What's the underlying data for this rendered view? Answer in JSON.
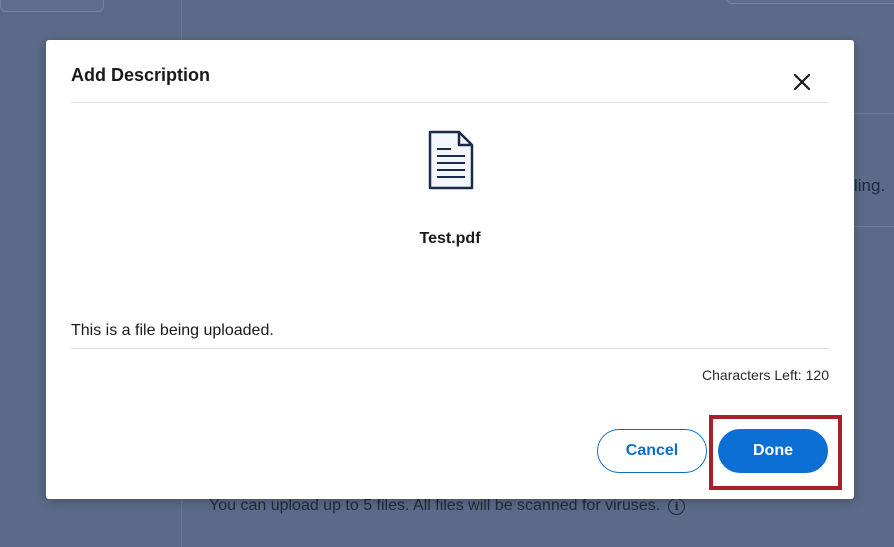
{
  "background": {
    "right_text": "ling.",
    "footer_text": "You can upload up to 5 files. All files will be scanned for viruses."
  },
  "modal": {
    "title": "Add Description",
    "file_name": "Test.pdf",
    "description_value": "This is a file being uploaded.",
    "chars_left_label": "Characters Left:",
    "chars_left_count": "120",
    "cancel_label": "Cancel",
    "done_label": "Done"
  },
  "icons": {
    "close": "close-icon",
    "file": "document-icon",
    "info": "info-icon"
  },
  "colors": {
    "primary": "#0b6fd6",
    "highlight": "#a5222a",
    "overlay": "#5b6a88"
  }
}
